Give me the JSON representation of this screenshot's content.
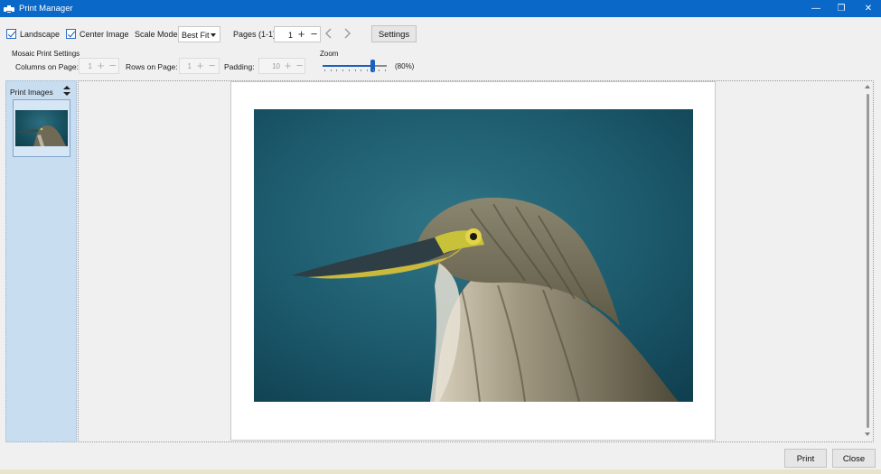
{
  "window": {
    "title": "Print Manager",
    "controls": {
      "minimize": "—",
      "maximize": "❐",
      "close": "✕"
    }
  },
  "toolbar": {
    "landscape_label": "Landscape",
    "landscape_checked": true,
    "center_image_label": "Center Image",
    "center_image_checked": true,
    "scale_mode_label": "Scale Mode:",
    "scale_mode_value": "Best Fit",
    "pages_label": "Pages (1-1):",
    "pages_value": "1",
    "settings_label": "Settings",
    "prev_icon": "chevron-left-icon",
    "next_icon": "chevron-right-icon"
  },
  "mosaic": {
    "title": "Mosaic Print Settings",
    "columns_label": "Columns on Page:",
    "columns_value": "1",
    "rows_label": "Rows on Page:",
    "rows_value": "1",
    "padding_label": "Padding:",
    "padding_value": "10"
  },
  "zoom": {
    "label": "Zoom",
    "percent_text": "(80%)",
    "level": 0.8
  },
  "sidebar": {
    "title": "Print Images",
    "sort_icon": "sort-updown-icon"
  },
  "footer": {
    "print_label": "Print",
    "close_label": "Close"
  },
  "colors": {
    "titlebar": "#0a68c9",
    "accent": "#1b5fbf",
    "side_panel": "#c9ddf0",
    "photo_bg": "#1c5a6c"
  }
}
